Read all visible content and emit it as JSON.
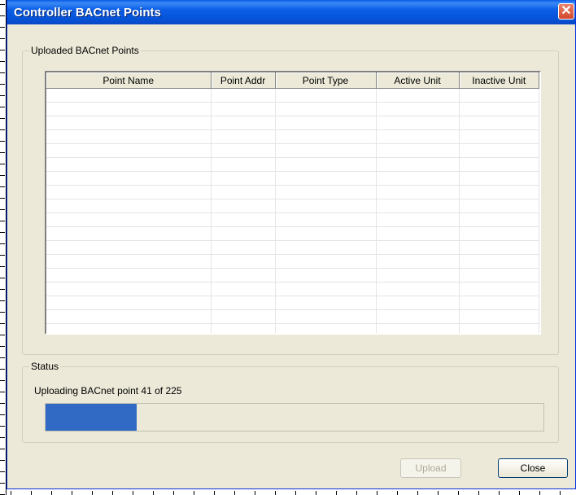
{
  "window": {
    "title": "Controller BACnet Points"
  },
  "icons": {
    "close": "close-icon"
  },
  "points_group": {
    "legend": "Uploaded BACnet Points",
    "columns": [
      "Point Name",
      "Point Addr",
      "Point Type",
      "Active Unit",
      "Inactive Unit"
    ],
    "rows": []
  },
  "status_group": {
    "legend": "Status",
    "message": "Uploading BACnet point 41 of 225",
    "progress_current": 41,
    "progress_total": 225
  },
  "buttons": {
    "upload": "Upload",
    "close": "Close",
    "upload_enabled": false
  },
  "colors": {
    "progress": "#316ac5",
    "titlebar": "#0554d9"
  }
}
